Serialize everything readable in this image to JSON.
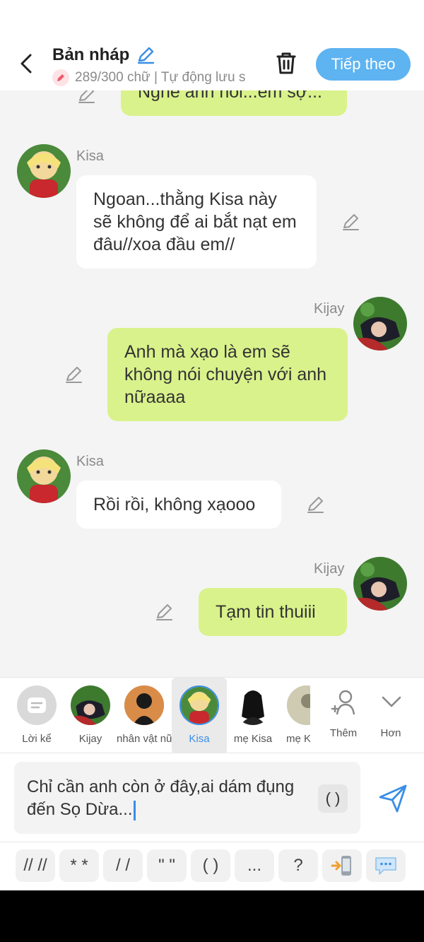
{
  "header": {
    "title": "Bản nháp",
    "subtitle": "289/300 chữ | Tự động lưu s",
    "next_label": "Tiếp theo"
  },
  "messages": [
    {
      "side": "me",
      "text": "Nghe anh nói...em sợ..."
    },
    {
      "side": "other",
      "name": "Kisa",
      "text": "Ngoan...thằng Kisa này sẽ không để ai bắt nạt em đâu//xoa đầu em//"
    },
    {
      "side": "me",
      "name": "Kijay",
      "text": "Anh mà xạo là em sẽ không nói chuyện với anh nữaaaa"
    },
    {
      "side": "other",
      "name": "Kisa",
      "text": "Rồi rồi, không xạooo"
    },
    {
      "side": "me",
      "name": "Kijay",
      "text": "Tạm tin thuiii"
    }
  ],
  "characters": [
    {
      "label": "Lời kể",
      "icon": "narration-icon"
    },
    {
      "label": "Kijay"
    },
    {
      "label": "nhân vật nữ"
    },
    {
      "label": "Kisa",
      "selected": true
    },
    {
      "label": "mẹ Kisa"
    },
    {
      "label": "mẹ K"
    },
    {
      "label": "Thêm",
      "icon": "add-user-icon"
    },
    {
      "label": "Hơn",
      "icon": "chevron-down-icon"
    }
  ],
  "input": {
    "text": "Chỉ cần anh còn ở đây,ai dám đụng đến Sọ Dừa...",
    "paren_label": "( )"
  },
  "symbols": [
    "// //",
    "* *",
    "/ /",
    "\" \"",
    "( )",
    "...",
    "?"
  ],
  "colors": {
    "accent": "#5eb3f1",
    "my_bubble": "#d9f28b",
    "other_bubble": "#ffffff",
    "selected": "#3a8ee6"
  }
}
